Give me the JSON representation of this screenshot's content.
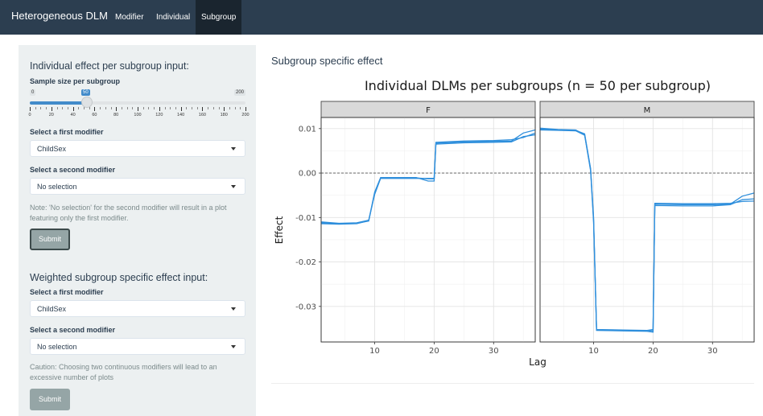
{
  "navbar": {
    "brand": "Heterogeneous DLM",
    "tabs": [
      {
        "label": "Modifier",
        "active": false
      },
      {
        "label": "Individual",
        "active": false
      },
      {
        "label": "Subgroup",
        "active": true
      }
    ]
  },
  "sidebar": {
    "individual": {
      "title": "Individual effect per subgroup input:",
      "slider": {
        "label": "Sample size per subgroup",
        "min": 0,
        "max": 200,
        "value": 50,
        "ticks": [
          "0",
          "20",
          "40",
          "60",
          "80",
          "100",
          "120",
          "140",
          "160",
          "180",
          "200"
        ]
      },
      "first_modifier_label": "Select a first modifier",
      "first_modifier_value": "ChildSex",
      "second_modifier_label": "Select a second modifier",
      "second_modifier_value": "No selection",
      "note": "Note: 'No selection' for the second modifier will result in a plot featuring only the first modifier.",
      "submit_label": "Submit"
    },
    "weighted": {
      "title": "Weighted subgroup specific effect input:",
      "first_modifier_label": "Select a first modifier",
      "first_modifier_value": "ChildSex",
      "second_modifier_label": "Select a second modifier",
      "second_modifier_value": "No selection",
      "note": "Caution: Choosing two continuous modifiers will lead to an excessive number of plots",
      "submit_label": "Submit"
    }
  },
  "main": {
    "title": "Subgroup specific effect"
  },
  "colors": {
    "line": "#2f8fdc",
    "navbar": "#2c3e50",
    "sidebar": "#ecf0f1"
  },
  "chart_data": {
    "type": "line",
    "title": "Individual DLMs per subgroups (n = 50 per subgroup)",
    "xlabel": "Lag",
    "ylabel": "Effect",
    "xlim": [
      1,
      37
    ],
    "ylim": [
      -0.038,
      0.0125
    ],
    "x_ticks": [
      10,
      20,
      30
    ],
    "y_ticks": [
      0.01,
      0.0,
      -0.01,
      -0.02,
      -0.03
    ],
    "y_tick_labels": [
      "0.01",
      "0.00",
      "-0.01",
      "-0.02",
      "-0.03"
    ],
    "reference_line": 0,
    "grid": true,
    "panels": [
      {
        "name": "F",
        "series": [
          {
            "points": [
              [
                1,
                -0.0112
              ],
              [
                4,
                -0.0114
              ],
              [
                7,
                -0.0113
              ],
              [
                9,
                -0.0108
              ],
              [
                10,
                -0.0045
              ],
              [
                11,
                -0.0011
              ],
              [
                14,
                -0.0011
              ],
              [
                17,
                -0.0011
              ],
              [
                19,
                -0.0013
              ],
              [
                20,
                -0.0013
              ],
              [
                20.3,
                0.0067
              ],
              [
                25,
                0.007
              ],
              [
                30,
                0.0071
              ],
              [
                33,
                0.0072
              ],
              [
                35,
                0.009
              ],
              [
                37,
                0.0097
              ]
            ]
          },
          {
            "points": [
              [
                1,
                -0.0114
              ],
              [
                4,
                -0.0115
              ],
              [
                7,
                -0.0114
              ],
              [
                9,
                -0.0107
              ],
              [
                10,
                -0.0043
              ],
              [
                11,
                -0.001
              ],
              [
                14,
                -0.001
              ],
              [
                17,
                -0.001
              ],
              [
                19,
                -0.0018
              ],
              [
                20,
                -0.0018
              ],
              [
                20.3,
                0.0065
              ],
              [
                25,
                0.0068
              ],
              [
                30,
                0.0069
              ],
              [
                33,
                0.007
              ],
              [
                35,
                0.0082
              ],
              [
                37,
                0.0086
              ]
            ]
          },
          {
            "points": [
              [
                1,
                -0.011
              ],
              [
                4,
                -0.0113
              ],
              [
                7,
                -0.0112
              ],
              [
                9,
                -0.0106
              ],
              [
                10,
                -0.0048
              ],
              [
                11,
                -0.0012
              ],
              [
                14,
                -0.0012
              ],
              [
                17,
                -0.0012
              ],
              [
                19,
                -0.0012
              ],
              [
                20,
                -0.0012
              ],
              [
                20.3,
                0.0069
              ],
              [
                25,
                0.0072
              ],
              [
                30,
                0.0073
              ],
              [
                33,
                0.0075
              ],
              [
                35,
                0.008
              ],
              [
                37,
                0.009
              ]
            ]
          }
        ]
      },
      {
        "name": "M",
        "series": [
          {
            "points": [
              [
                1,
                0.0099
              ],
              [
                4,
                0.0097
              ],
              [
                7,
                0.0096
              ],
              [
                8.5,
                0.0088
              ],
              [
                9.5,
                0.001
              ],
              [
                10,
                -0.01
              ],
              [
                10.5,
                -0.0353
              ],
              [
                15,
                -0.0354
              ],
              [
                19,
                -0.0354
              ],
              [
                20,
                -0.0352
              ],
              [
                20.3,
                -0.007
              ],
              [
                25,
                -0.0071
              ],
              [
                30,
                -0.0071
              ],
              [
                33,
                -0.007
              ],
              [
                35,
                -0.0052
              ],
              [
                37,
                -0.0045
              ]
            ]
          },
          {
            "points": [
              [
                1,
                0.0101
              ],
              [
                4,
                0.0098
              ],
              [
                7,
                0.0097
              ],
              [
                8.5,
                0.0086
              ],
              [
                9.5,
                0.0005
              ],
              [
                10,
                -0.011
              ],
              [
                10.5,
                -0.0354
              ],
              [
                15,
                -0.0355
              ],
              [
                19,
                -0.0356
              ],
              [
                20,
                -0.0358
              ],
              [
                20.3,
                -0.0073
              ],
              [
                25,
                -0.0074
              ],
              [
                30,
                -0.0074
              ],
              [
                33,
                -0.0071
              ],
              [
                35,
                -0.006
              ],
              [
                37,
                -0.0058
              ]
            ]
          },
          {
            "points": [
              [
                1,
                0.0097
              ],
              [
                4,
                0.0096
              ],
              [
                7,
                0.0095
              ],
              [
                8.5,
                0.0085
              ],
              [
                9.5,
                0.0008
              ],
              [
                10,
                -0.0105
              ],
              [
                10.5,
                -0.0352
              ],
              [
                15,
                -0.0353
              ],
              [
                19,
                -0.0354
              ],
              [
                20,
                -0.0355
              ],
              [
                20.3,
                -0.0068
              ],
              [
                25,
                -0.0069
              ],
              [
                30,
                -0.0069
              ],
              [
                33,
                -0.0068
              ],
              [
                35,
                -0.0064
              ],
              [
                37,
                -0.0063
              ]
            ]
          }
        ]
      }
    ]
  }
}
